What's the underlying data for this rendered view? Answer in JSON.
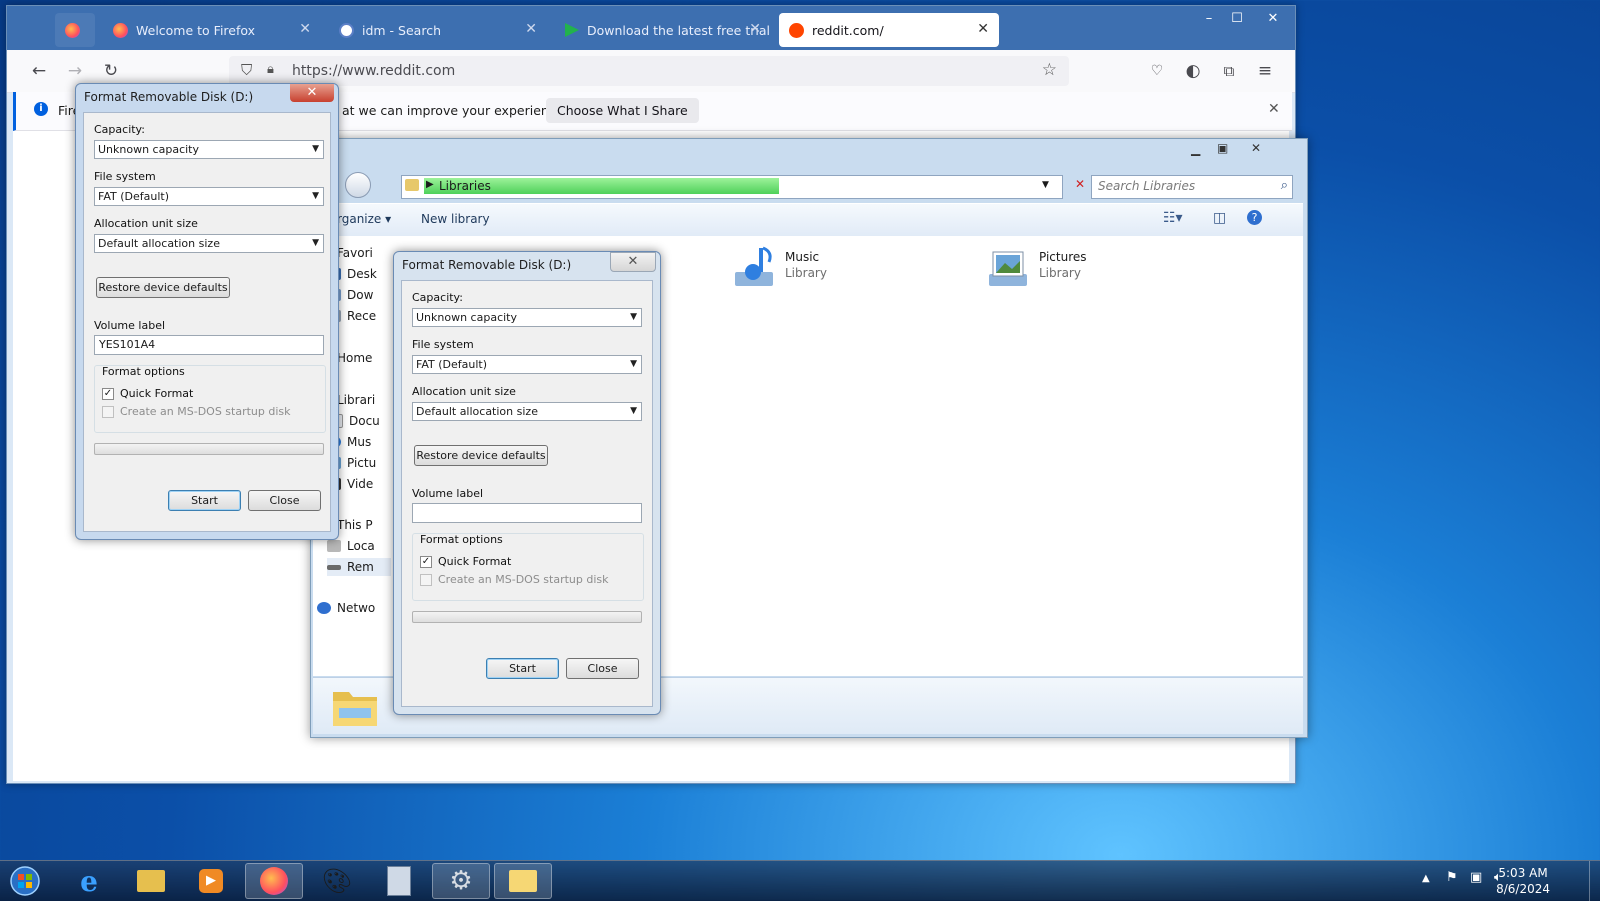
{
  "browser": {
    "tabs": [
      {
        "label": "",
        "icon": "firefox-icon"
      },
      {
        "label": "Welcome to Firefox",
        "icon": "firefox-icon"
      },
      {
        "label": "idm - Search",
        "icon": "search-icon"
      },
      {
        "label": "Download the latest free trial ve",
        "icon": "download-arrow-icon"
      },
      {
        "label": "reddit.com/",
        "icon": "reddit-icon"
      }
    ],
    "url": "https://www.reddit.com",
    "notification": {
      "text_start": "Fire",
      "text_end": "at we can improve your experience.",
      "button": "Choose What I Share"
    },
    "window_buttons": {
      "minimize": "–",
      "maximize": "☐",
      "close": "✕"
    }
  },
  "explorer": {
    "address": "Libraries",
    "search_placeholder": "Search Libraries",
    "toolbar": {
      "organize": "rganize",
      "new_library": "New library"
    },
    "nav": [
      {
        "label": "Favori"
      },
      {
        "label": "Desk"
      },
      {
        "label": "Dow"
      },
      {
        "label": "Rece"
      },
      {
        "label": "Home"
      },
      {
        "label": "Librari"
      },
      {
        "label": "Docu"
      },
      {
        "label": "Mus"
      },
      {
        "label": "Pictu"
      },
      {
        "label": "Vide"
      },
      {
        "label": "This P"
      },
      {
        "label": "Loca"
      },
      {
        "label": "Rem"
      },
      {
        "label": "Netwo"
      }
    ],
    "libraries": [
      {
        "name": "Music",
        "type": "Library"
      },
      {
        "name": "Pictures",
        "type": "Library"
      }
    ]
  },
  "dialog_a": {
    "title": "Format Removable Disk (D:)",
    "capacity_label": "Capacity:",
    "capacity_value": "Unknown capacity",
    "filesystem_label": "File system",
    "filesystem_value": "FAT (Default)",
    "allocation_label": "Allocation unit size",
    "allocation_value": "Default allocation size",
    "restore_button": "Restore device defaults",
    "volume_label": "Volume label",
    "volume_value": "YES101A4",
    "format_options": "Format options",
    "quick_format": "Quick Format",
    "msdos": "Create an MS-DOS startup disk",
    "start": "Start",
    "close": "Close"
  },
  "dialog_b": {
    "title": "Format Removable Disk (D:)",
    "capacity_label": "Capacity:",
    "capacity_value": "Unknown capacity",
    "filesystem_label": "File system",
    "filesystem_value": "FAT (Default)",
    "allocation_label": "Allocation unit size",
    "allocation_value": "Default allocation size",
    "restore_button": "Restore device defaults",
    "volume_label": "Volume label",
    "volume_value": "",
    "format_options": "Format options",
    "quick_format": "Quick Format",
    "msdos": "Create an MS-DOS startup disk",
    "start": "Start",
    "close": "Close"
  },
  "taskbar": {
    "time": "5:03 AM",
    "date": "8/6/2024",
    "items": [
      "start-orb-icon",
      "internet-explorer-icon",
      "file-explorer-icon",
      "media-player-icon",
      "firefox-icon",
      "paint-icon",
      "calculator-icon",
      "settings-gear-icon",
      "folder-icon"
    ]
  },
  "colors": {
    "accent": "#0060df",
    "close_red": "#c7402f",
    "taskbar": "#1e3c64"
  }
}
